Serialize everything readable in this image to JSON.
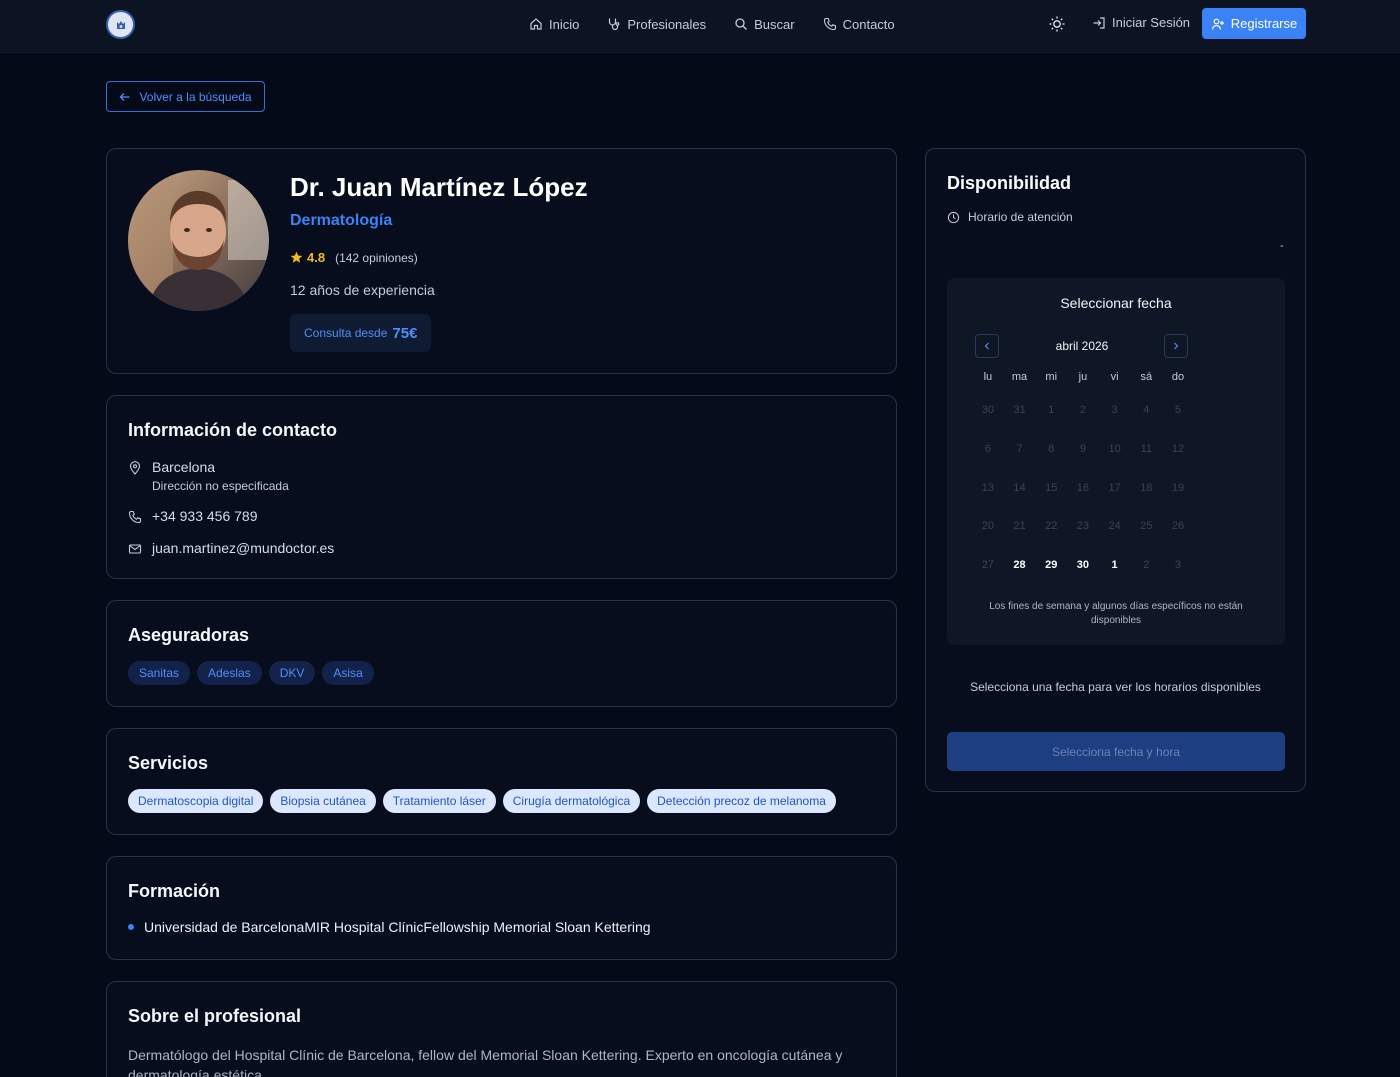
{
  "nav": {
    "links": [
      {
        "label": "Inicio",
        "icon": "home-icon"
      },
      {
        "label": "Profesionales",
        "icon": "stethoscope-icon"
      },
      {
        "label": "Buscar",
        "icon": "search-icon"
      },
      {
        "label": "Contacto",
        "icon": "phone-icon"
      }
    ],
    "login_label": "Iniciar Sesión",
    "register_label": "Registrarse",
    "theme_icon": "sun-icon"
  },
  "back_label": "Volver a la búsqueda",
  "profile": {
    "name": "Dr. Juan Martínez López",
    "specialty": "Dermatología",
    "rating": "4.8",
    "reviews": "(142 opiniones)",
    "experience": "12 años de experiencia",
    "price_label": "Consulta desde",
    "price_value": "75€"
  },
  "contact": {
    "title": "Información de contacto",
    "city": "Barcelona",
    "address": "Dirección no especificada",
    "phone": "+34 933 456 789",
    "email": "juan.martinez@mundoctor.es"
  },
  "insurers": {
    "title": "Aseguradoras",
    "items": [
      "Sanitas",
      "Adeslas",
      "DKV",
      "Asisa"
    ]
  },
  "services": {
    "title": "Servicios",
    "items": [
      "Dermatoscopia digital",
      "Biopsia cutánea",
      "Tratamiento láser",
      "Cirugía dermatológica",
      "Detección precoz de melanoma"
    ]
  },
  "education": {
    "title": "Formación",
    "text": "Universidad de BarcelonaMIR Hospital ClínicFellowship Memorial Sloan Kettering"
  },
  "about": {
    "title": "Sobre el profesional",
    "text": "Dermatólogo del Hospital Clínic de Barcelona, fellow del Memorial Sloan Kettering. Experto en oncología cutánea y dermatología estética."
  },
  "availability": {
    "title": "Disponibilidad",
    "hours_label": "Horario de atención",
    "dash": "-",
    "calendar_title": "Seleccionar fecha",
    "month": "abril 2026",
    "weekdays": [
      "lu",
      "ma",
      "mi",
      "ju",
      "vi",
      "sá",
      "do"
    ],
    "weeks": [
      [
        "30",
        "31",
        "1",
        "2",
        "3",
        "4",
        "5"
      ],
      [
        "6",
        "7",
        "8",
        "9",
        "10",
        "11",
        "12"
      ],
      [
        "13",
        "14",
        "15",
        "16",
        "17",
        "18",
        "19"
      ],
      [
        "20",
        "21",
        "22",
        "23",
        "24",
        "25",
        "26"
      ],
      [
        "27",
        "28",
        "29",
        "30",
        "1",
        "2",
        "3"
      ]
    ],
    "available_days": [
      "28",
      "29",
      "30",
      "1"
    ],
    "note": "Los fines de semana y algunos días específicos no están disponibles",
    "select_hint": "Selecciona una fecha para ver los horarios disponibles",
    "book_label": "Selecciona fecha y hora"
  },
  "colors": {
    "accent": "#3b82f6",
    "background": "#050a18",
    "star": "#f5b921"
  }
}
